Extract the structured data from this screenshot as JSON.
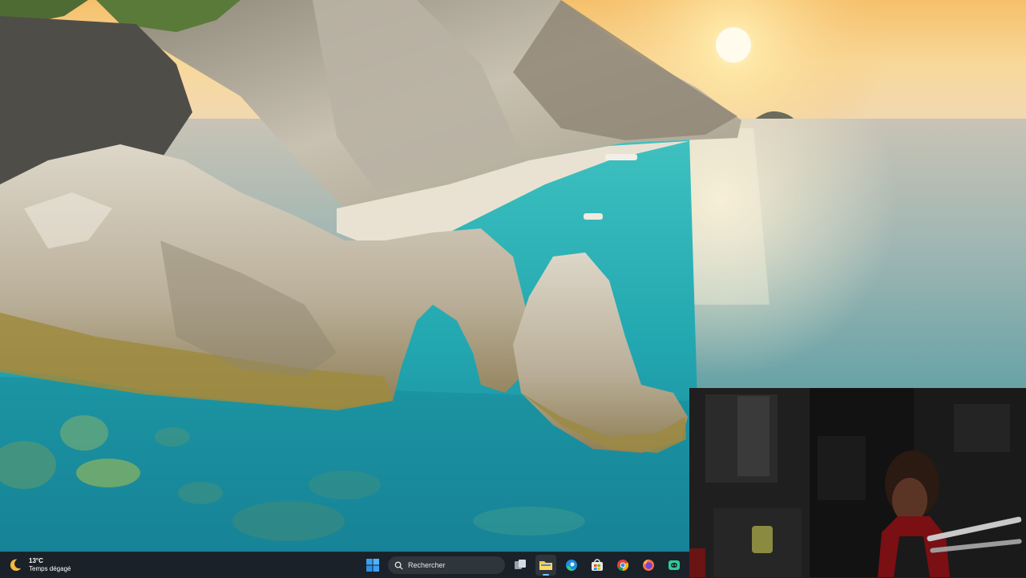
{
  "taskbar": {
    "weather": {
      "temperature": "13°C",
      "condition": "Temps dégagé",
      "icon": "moon-icon"
    },
    "search": {
      "placeholder": "Rechercher",
      "icon": "search-icon"
    },
    "apps": [
      {
        "name": "start",
        "icon": "windows-logo-icon"
      },
      {
        "name": "task-view",
        "icon": "task-view-icon"
      },
      {
        "name": "file-explorer",
        "icon": "folder-icon",
        "active": true
      },
      {
        "name": "edge",
        "icon": "edge-icon"
      },
      {
        "name": "store",
        "icon": "store-icon"
      },
      {
        "name": "chrome",
        "icon": "chrome-icon"
      },
      {
        "name": "firefox",
        "icon": "firefox-icon"
      },
      {
        "name": "discord",
        "icon": "discord-icon"
      }
    ]
  },
  "colors": {
    "taskbar": "#1a1e24",
    "accent": "#7cc4ff",
    "sea": "#2fb3b8",
    "sky": "#f4b463"
  }
}
